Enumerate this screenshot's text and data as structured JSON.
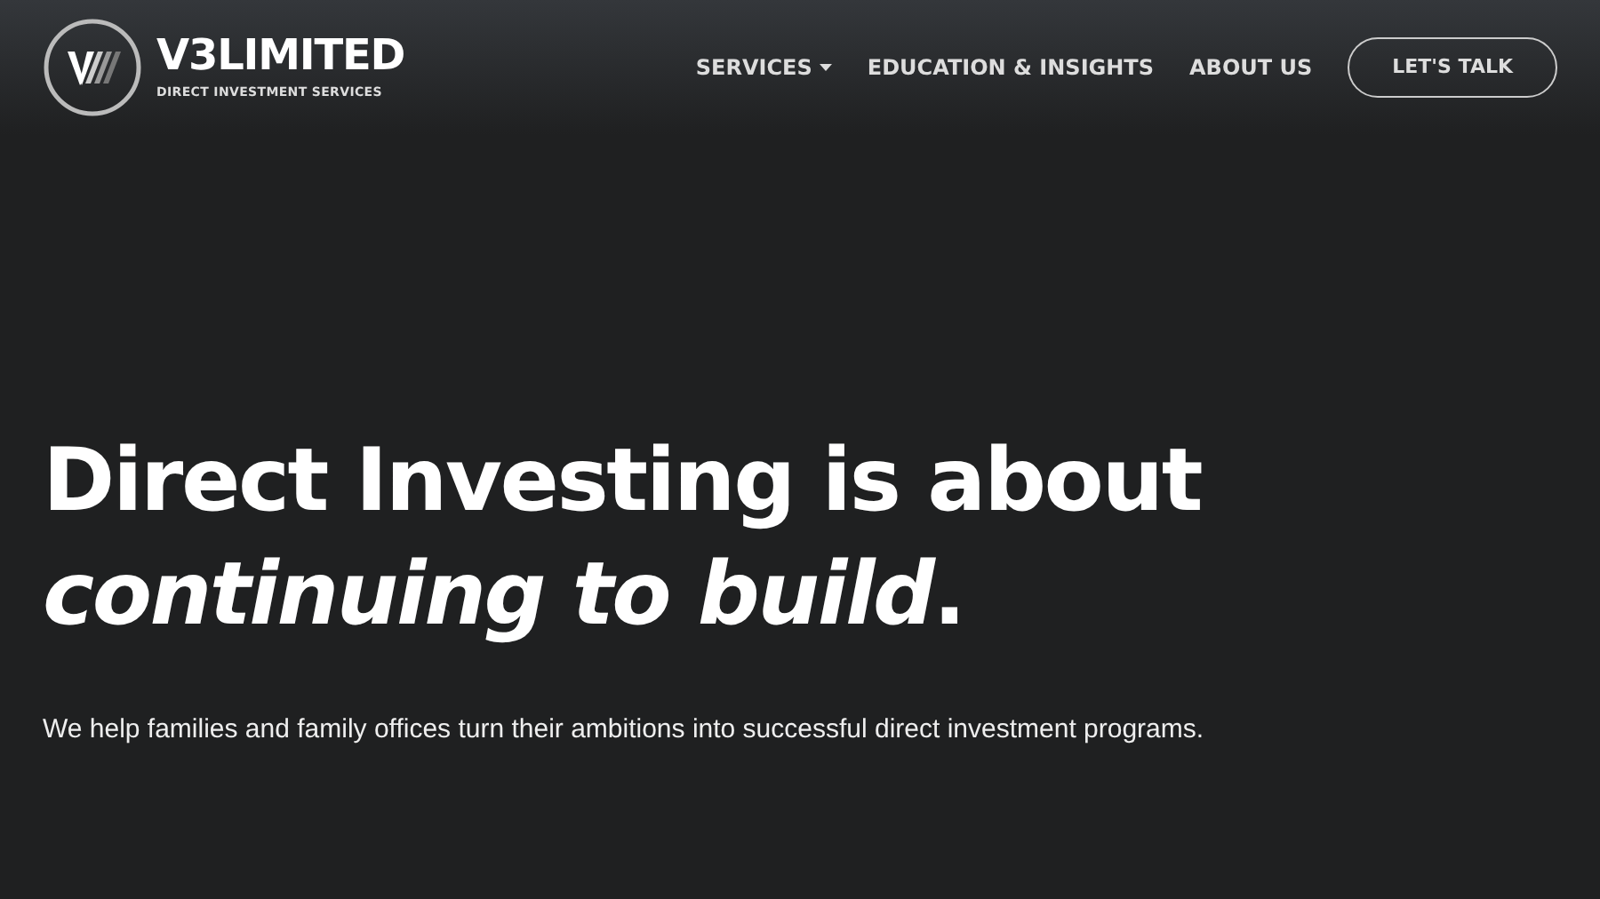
{
  "header": {
    "brand": {
      "name": "V3LIMITED",
      "tagline": "DIRECT INVESTMENT SERVICES"
    },
    "nav": [
      {
        "label": "SERVICES",
        "dropdown": true
      },
      {
        "label": "EDUCATION & INSIGHTS",
        "dropdown": false
      },
      {
        "label": "ABOUT US",
        "dropdown": false
      }
    ],
    "cta": "LET'S TALK"
  },
  "hero": {
    "headline": [
      "Direct Investing is about",
      "*continuing to build*."
    ],
    "subtitle": "We help families and family offices turn their ambitions into successful direct investment programs."
  }
}
